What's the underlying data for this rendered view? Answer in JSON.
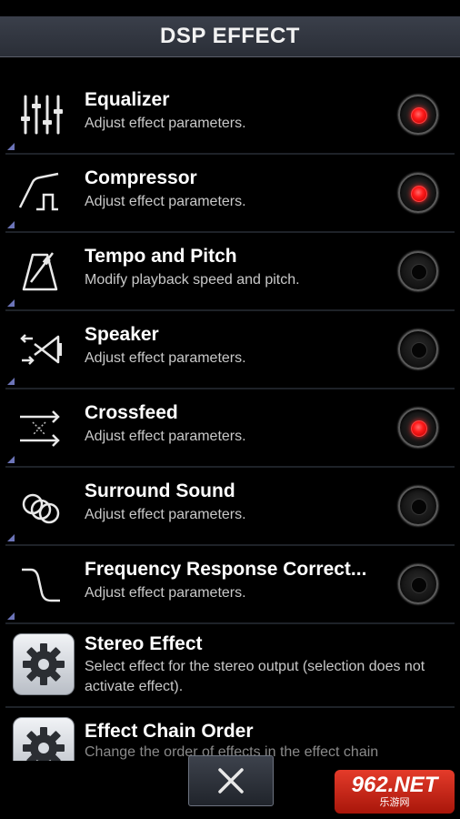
{
  "header": {
    "title": "DSP EFFECT"
  },
  "effects": [
    {
      "title": "Equalizer",
      "desc": "Adjust effect parameters.",
      "enabled": true,
      "icon": "equalizer-sliders-icon"
    },
    {
      "title": "Compressor",
      "desc": "Adjust effect parameters.",
      "enabled": true,
      "icon": "compressor-curve-icon"
    },
    {
      "title": "Tempo and Pitch",
      "desc": "Modify playback speed and pitch.",
      "enabled": false,
      "icon": "metronome-icon"
    },
    {
      "title": "Speaker",
      "desc": "Adjust effect parameters.",
      "enabled": false,
      "icon": "speaker-icon"
    },
    {
      "title": "Crossfeed",
      "desc": "Adjust effect parameters.",
      "enabled": true,
      "icon": "crossfeed-arrows-icon"
    },
    {
      "title": "Surround Sound",
      "desc": "Adjust effect parameters.",
      "enabled": false,
      "icon": "surround-circles-icon"
    },
    {
      "title": "Frequency Response Correct...",
      "desc": "Adjust effect parameters.",
      "enabled": false,
      "icon": "frequency-curve-icon"
    }
  ],
  "settings": [
    {
      "title": "Stereo Effect",
      "desc": "Select effect for the stereo output (selection does not activate effect).",
      "icon": "gear-icon"
    },
    {
      "title": "Effect Chain Order",
      "desc": "Change the order of effects in the effect chain",
      "icon": "gear-icon"
    }
  ],
  "footer": {
    "close_icon": "close-icon"
  },
  "watermark": {
    "brand": "962.NET",
    "sub": "乐游网"
  },
  "colors": {
    "accent_on": "#ff1a1a",
    "header_bg": "#2f333c",
    "corner": "#6c74b8"
  }
}
